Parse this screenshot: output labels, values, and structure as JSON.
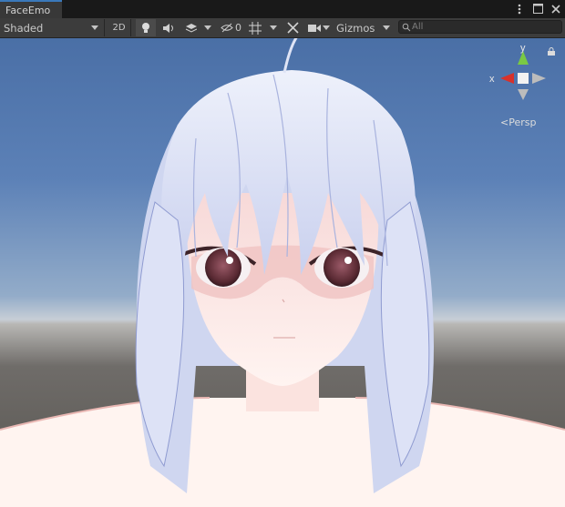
{
  "window": {
    "tab_title": "FaceEmo",
    "controls": [
      "kebab-menu-icon",
      "maximize-icon",
      "close-icon"
    ]
  },
  "toolbar": {
    "shading_mode": "Shaded",
    "mode_2d": "2D",
    "hidden_count": "0",
    "gizmos_label": "Gizmos",
    "search_placeholder": "All"
  },
  "scene_gizmo": {
    "x_label": "x",
    "y_label": "y",
    "projection_label": "Persp",
    "colors": {
      "x_axis": "#d8322b",
      "y_axis": "#7ac943",
      "neutral": "#bcbcbc"
    }
  }
}
